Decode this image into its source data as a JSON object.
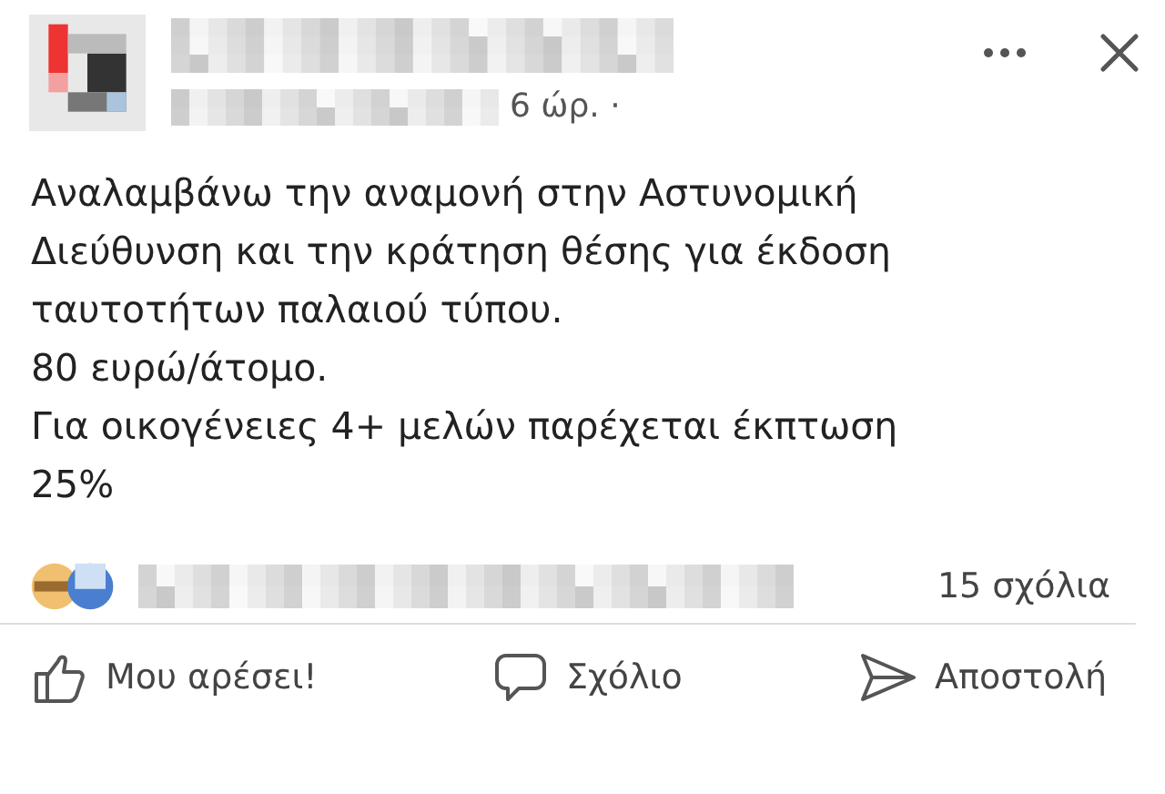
{
  "post": {
    "time": "6 ώρ. ·",
    "lines": [
      "Αναλαμβάνω την αναμονή στην Αστυνομική",
      "Διεύθυνση και την κράτηση θέσης για έκδοση",
      "ταυτοτήτων παλαιού τύπου.",
      "80 ευρώ/άτομο.",
      "Για οικογένειες 4+ μελών παρέχεται έκπτωση",
      "25%"
    ],
    "comments": "15 σχόλια"
  },
  "actions": [
    {
      "kind": "like",
      "label": "Μου αρέσει!"
    },
    {
      "kind": "comment",
      "label": "Σχόλιο"
    },
    {
      "kind": "share",
      "label": "Αποστολή"
    }
  ]
}
